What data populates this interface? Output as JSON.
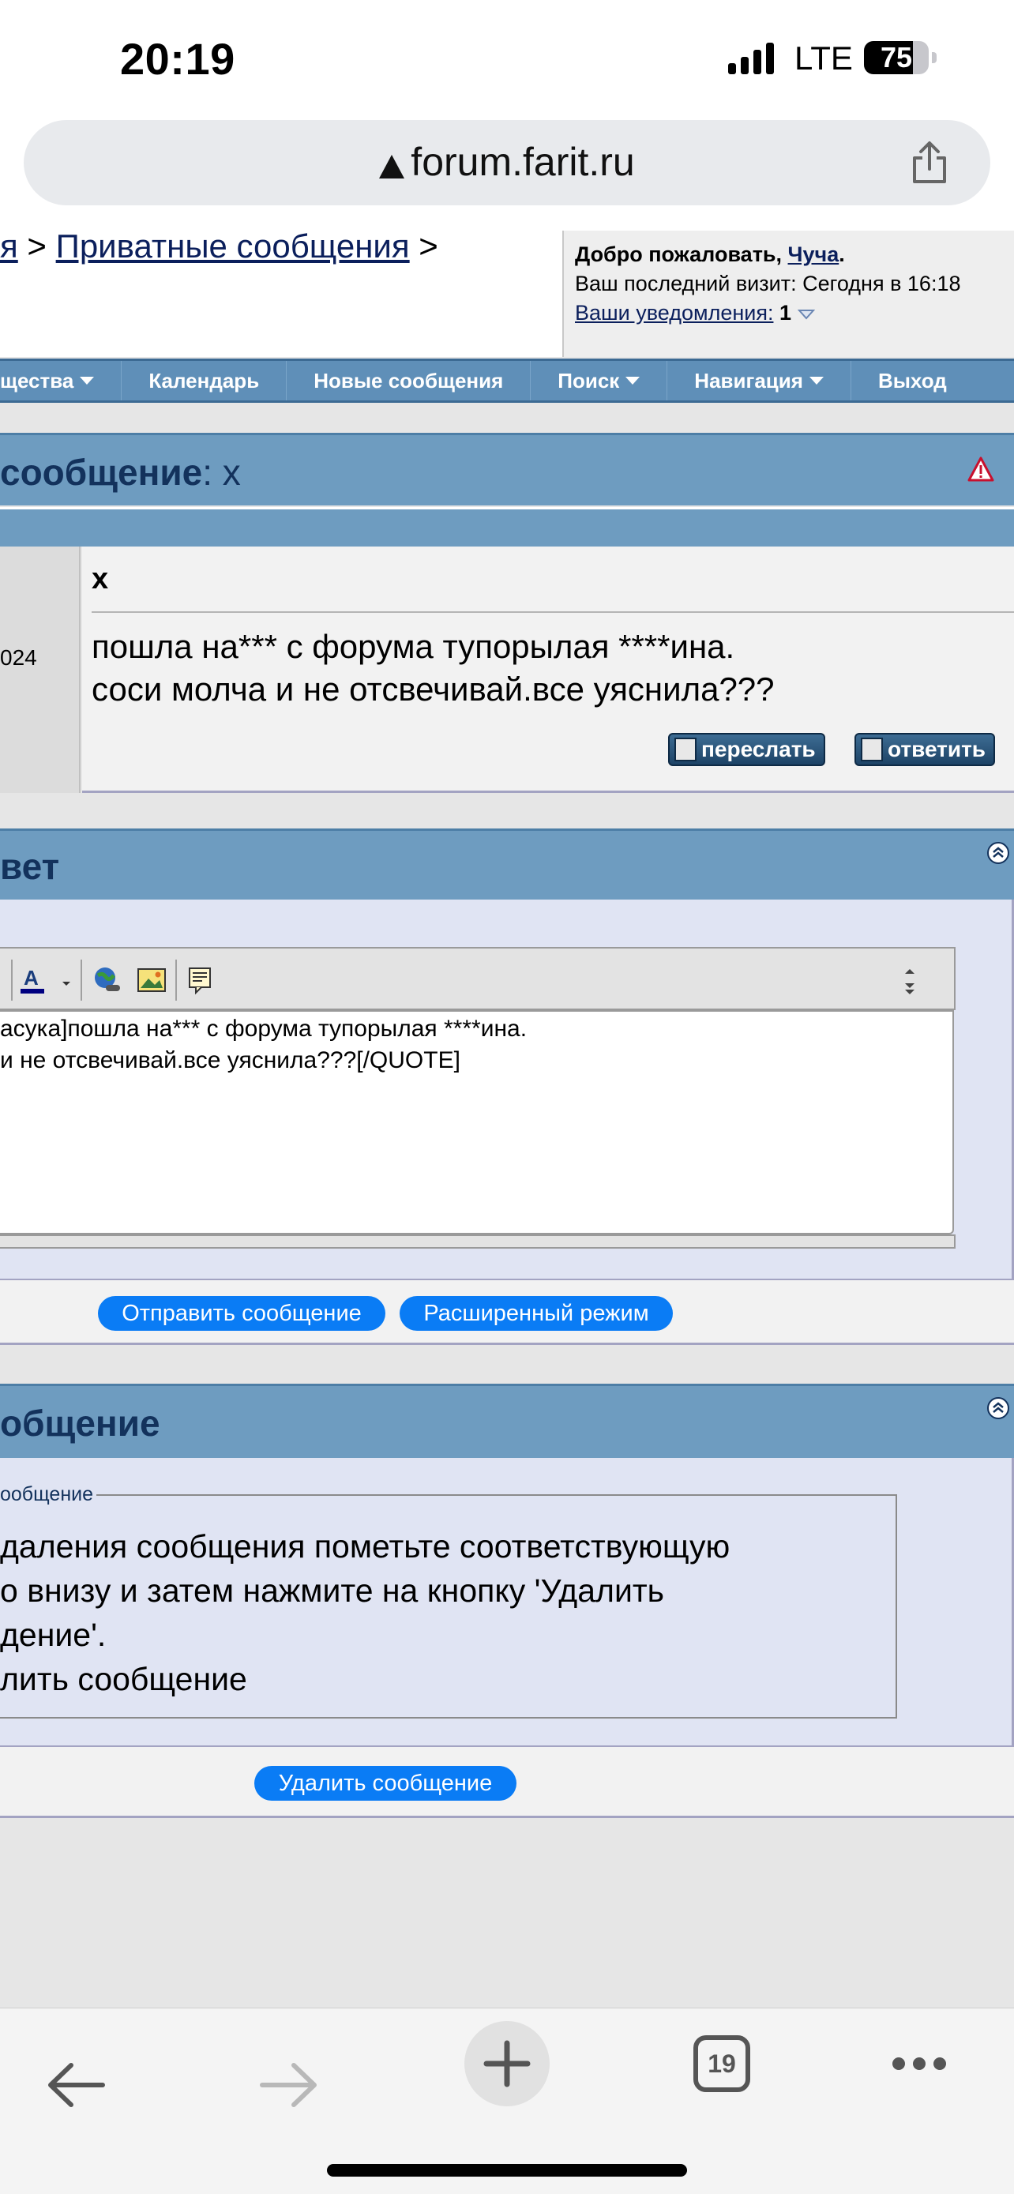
{
  "status_bar": {
    "time": "20:19",
    "network": "LTE",
    "battery": "75",
    "battery_level": 0.75
  },
  "address_bar": {
    "url": "forum.farit.ru",
    "warning_icon": "warning-triangle-icon",
    "share_icon": "share-icon"
  },
  "header": {
    "breadcrumb_partial": "я",
    "breadcrumb_sep": " > ",
    "breadcrumb_link": "Приватные сообщения",
    "breadcrumb_tail": " >",
    "welcome_label": "Добро пожаловать, ",
    "welcome_user": "Чуча",
    "welcome_end": ".",
    "last_visit": "Ваш последний визит: Сегодня в 16:18",
    "notifications_label": "Ваши уведомления:",
    "notifications_count": "1"
  },
  "navbar": {
    "items": [
      {
        "label": "щества",
        "dropdown": true
      },
      {
        "label": "Календарь",
        "dropdown": false
      },
      {
        "label": "Новые сообщения",
        "dropdown": false
      },
      {
        "label": "Поиск",
        "dropdown": true
      },
      {
        "label": "Навигация",
        "dropdown": true
      },
      {
        "label": "Выход",
        "dropdown": false
      }
    ]
  },
  "message": {
    "title_prefix": "сообщение",
    "title_sep": ": ",
    "title_subject": "x",
    "date_partial": "024",
    "subject": "x",
    "body_line1": "пошла на*** с форума тупорылая ****ина.",
    "body_line2": "соси молча и не отсвечивай.все уяснила???",
    "forward_button": "переслать",
    "reply_button": "ответить"
  },
  "quick_reply": {
    "title": "вет",
    "editor_line1": "асука]пошла на*** с форума тупорылая ****ина.",
    "editor_line2": "и не отсвечивай.все уяснила???[/QUOTE]",
    "submit_button": "Отправить сообщение",
    "advanced_button": "Расширенный режим",
    "colors": {
      "font_color_bar": "#000080"
    }
  },
  "delete_section": {
    "title": "общение",
    "legend": "ообщение",
    "text_line1": "даления сообщения пометьте соответствующую",
    "text_line2": "о внизу и затем нажмите на кнопку 'Удалить",
    "text_line3": "дение'.",
    "text_line4": "лить сообщение",
    "delete_button": "Удалить сообщение"
  },
  "bottom_toolbar": {
    "tab_count": "19"
  },
  "colors": {
    "header_blue": "#6e9cc0",
    "nav_blue": "#5f8fb8",
    "title_text": "#13325c",
    "pill_button": "#0a7cf5",
    "panel_bg": "#e0e4f3"
  }
}
